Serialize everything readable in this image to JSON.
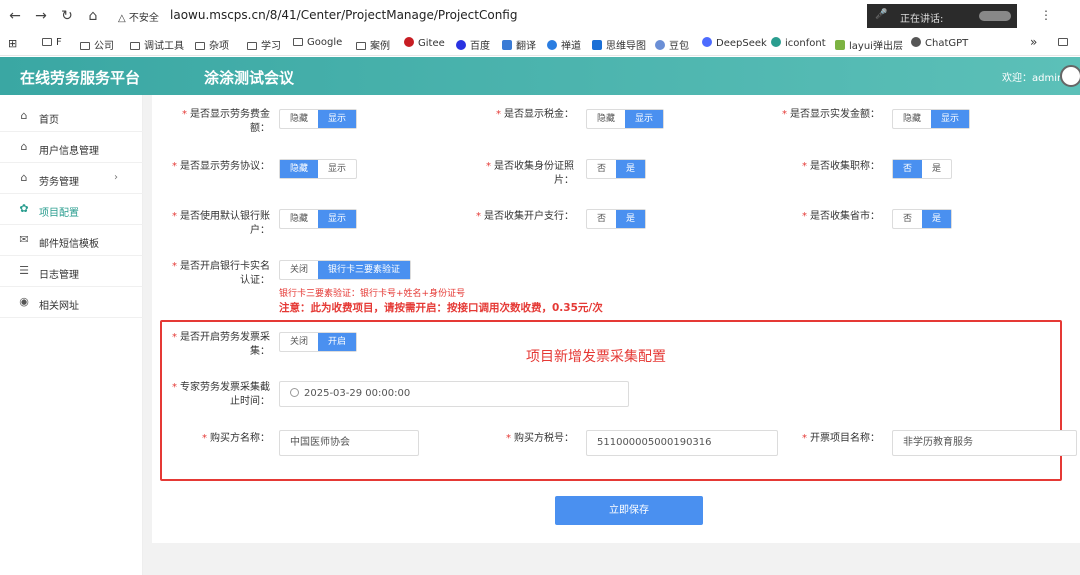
{
  "browser": {
    "insecure_label": "△ 不安全",
    "url": "laowu.mscps.cn/8/41/Center/ProjectManage/ProjectConfig",
    "speaking_label": "正在讲话:",
    "bookmarks": [
      "F",
      "公司",
      "调试工具",
      "杂项",
      "学习",
      "Google",
      "案例",
      "Gitee",
      "百度",
      "翻译",
      "禅道",
      "思维导图",
      "豆包",
      "DeepSeek",
      "iconfont",
      "layui弹出层",
      "ChatGPT"
    ],
    "bookmarks_more": "»"
  },
  "header": {
    "app_title": "在线劳务服务平台",
    "meeting_title": "涂涂测试会议",
    "welcome": "欢迎：admin"
  },
  "sidebar": {
    "items": [
      {
        "label": "首页",
        "icon": "home-icon"
      },
      {
        "label": "用户信息管理",
        "icon": "home-icon"
      },
      {
        "label": "劳务管理",
        "icon": "home-icon",
        "arrow": "›"
      },
      {
        "label": "项目配置",
        "icon": "gear-icon"
      },
      {
        "label": "邮件短信模板",
        "icon": "mail-icon"
      },
      {
        "label": "日志管理",
        "icon": "list-icon"
      },
      {
        "label": "相关网址",
        "icon": "globe-icon"
      }
    ]
  },
  "form": {
    "hide": "隐藏",
    "show": "显示",
    "no": "否",
    "yes": "是",
    "off": "关闭",
    "on": "开启",
    "bank_verify": "银行卡三要素验证",
    "fields": {
      "show_fee": "是否显示劳务费金额：",
      "show_tax": "是否显示税金：",
      "show_actual": "是否显示实发金额：",
      "show_agreement": "是否显示劳务协议：",
      "collect_idphoto": "是否收集身份证照片：",
      "collect_title": "是否收集职称：",
      "default_bank": "是否使用默认银行账户：",
      "collect_branch": "是否收集开户支行：",
      "collect_province": "是否收集省市：",
      "bank_realname": "是否开启银行卡实名认证：",
      "invoice_collect": "是否开启劳务发票采集：",
      "invoice_deadline": "专家劳务发票采集截止时间：",
      "buyer_name": "购买方名称：",
      "buyer_tax": "购买方税号：",
      "project_name": "开票项目名称："
    },
    "bank_note": "银行卡三要素验证：银行卡号+姓名+身份证号",
    "bank_warning": "注意：此为收费项目，请按需开启：按接口调用次数收费，0.35元/次",
    "box_title": "项目新增发票采集配置",
    "deadline_value": "2025-03-29 00:00:00",
    "buyer_name_value": "中国医师协会",
    "buyer_tax_value": "511000005000190316",
    "project_name_value": "非学历教育服务",
    "save_label": "立即保存"
  }
}
